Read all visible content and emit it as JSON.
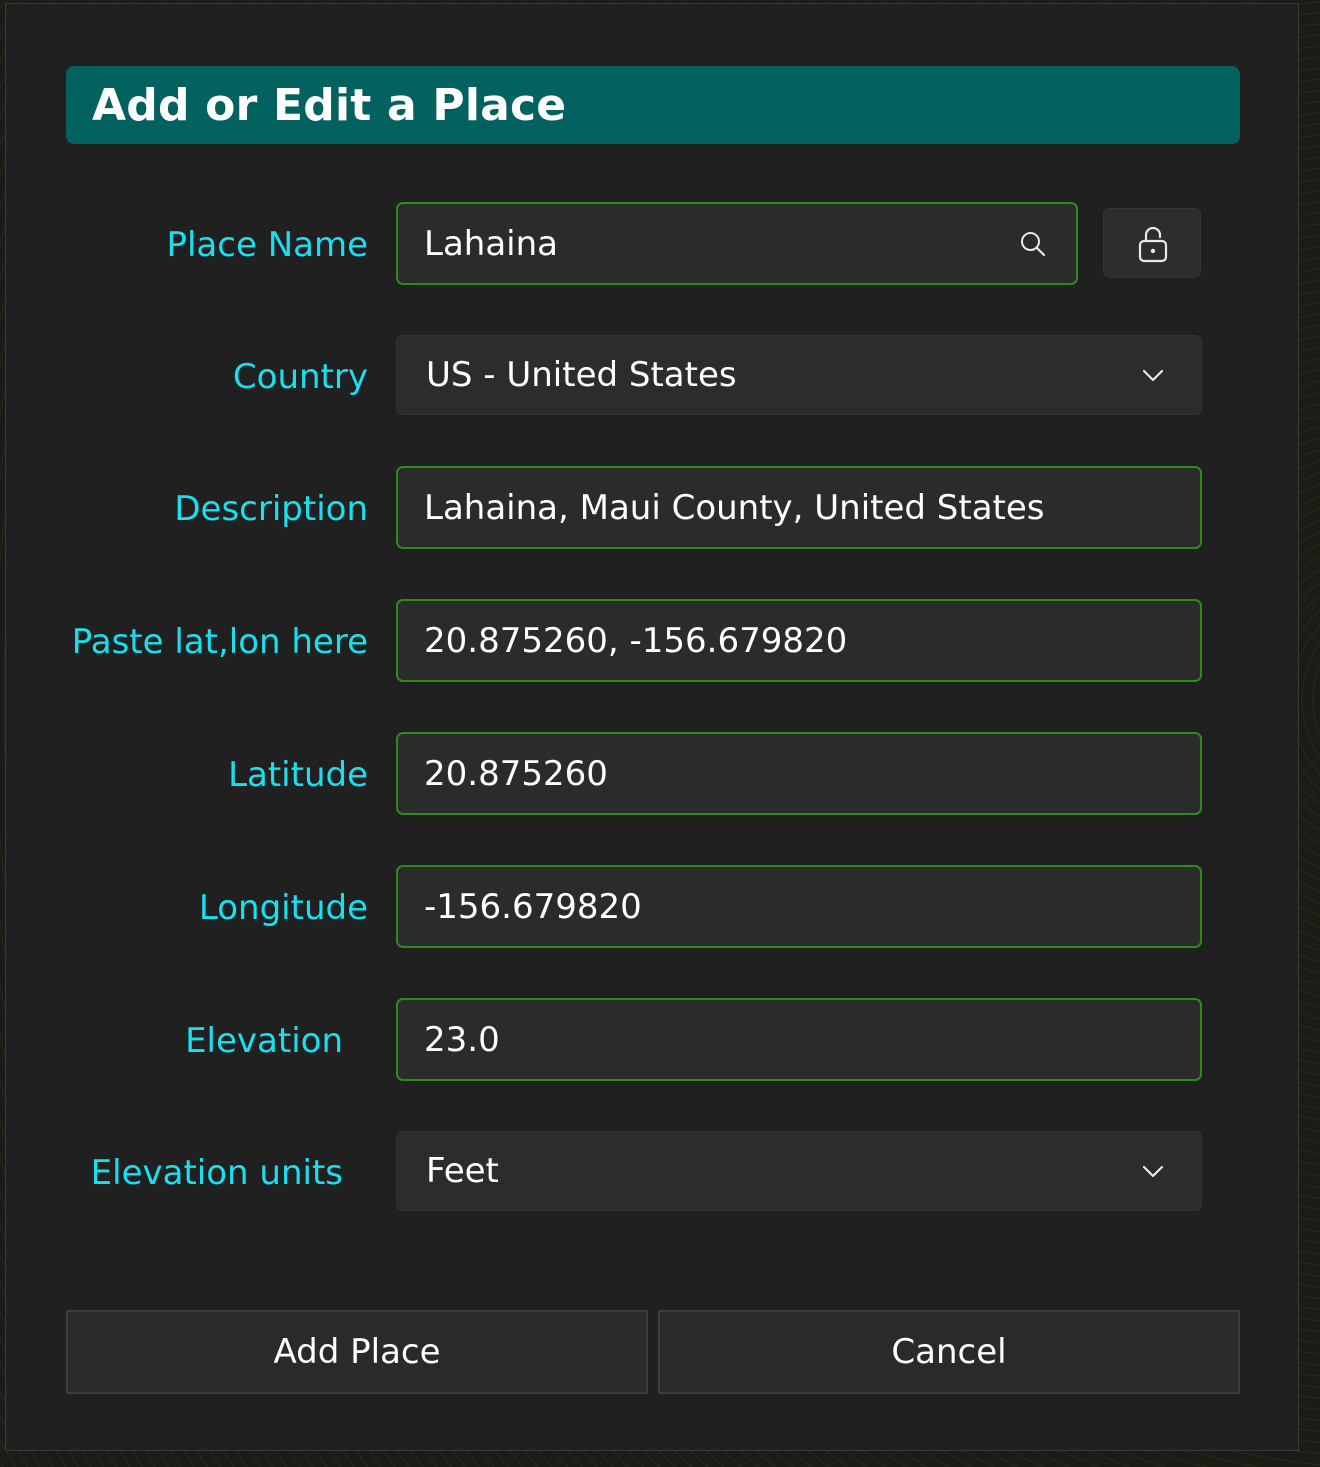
{
  "dialog": {
    "title": "Add or Edit a Place"
  },
  "form": {
    "place_name": {
      "label": "Place Name",
      "value": "Lahaina"
    },
    "country": {
      "label": "Country",
      "selected": "US - United States"
    },
    "description": {
      "label": "Description",
      "value": "Lahaina, Maui County, United States"
    },
    "paste_latlon": {
      "label": "Paste lat,lon here",
      "value": "20.875260, -156.679820"
    },
    "latitude": {
      "label": "Latitude",
      "value": "20.875260"
    },
    "longitude": {
      "label": "Longitude",
      "value": "-156.679820"
    },
    "elevation": {
      "label": "Elevation",
      "value": "23.0"
    },
    "elevation_units": {
      "label": "Elevation units",
      "selected": "Feet"
    }
  },
  "icons": {
    "search": "search-icon",
    "lock": "lock-icon",
    "dropdown": "chevron-down-icon"
  },
  "buttons": {
    "add": "Add Place",
    "cancel": "Cancel"
  },
  "colors": {
    "title_bar": "#03615f",
    "label_text": "#19e0ef",
    "field_border": "#2f8a1c",
    "dialog_bg": "#202020"
  }
}
